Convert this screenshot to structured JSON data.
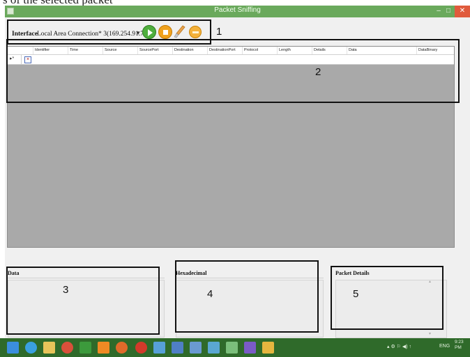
{
  "caption_fragment": "s of the selected packet",
  "window": {
    "title": "Packet Sniffing",
    "minimize_glyph": "–",
    "maximize_glyph": "□",
    "close_glyph": "✕"
  },
  "toolbar": {
    "interface_label": "Interface",
    "interface_value": "Local Area Connection* 3(169.254.91.73)",
    "dropdown_glyph": "▾",
    "icons": [
      "start-capture-icon",
      "stop-capture-icon",
      "clear-icon",
      "save-icon"
    ]
  },
  "grid": {
    "columns": [
      "Identifier",
      "Time",
      "Source",
      "SourcePort",
      "Destination",
      "DestinationPort",
      "Protocol",
      "Length",
      "Details",
      "Data",
      "DataBinary"
    ],
    "row_marker": "▸*",
    "row_cell": "×"
  },
  "panels": {
    "data": {
      "title": "Data"
    },
    "hex": {
      "title": "Hexadecimal"
    },
    "details": {
      "title": "Packet Details"
    },
    "scroll_up": "▴",
    "scroll_down": "▾"
  },
  "annotations": [
    "1",
    "2",
    "3",
    "4",
    "5"
  ],
  "taskbar": {
    "icons": [
      "start-icon",
      "ie-icon",
      "explorer-icon",
      "chrome-icon",
      "store-icon",
      "vlc-icon",
      "firefox-icon",
      "opera-icon",
      "network-icon",
      "word-icon",
      "settings-icon",
      "paint-icon",
      "tool-icon",
      "visual-studio-icon",
      "app-icon"
    ],
    "tray": "▴ ⚙ ⚐ ◀) ↑",
    "lang": "ENG",
    "time": "9:23 PM"
  },
  "colors": {
    "titlebar": "#6aa95c",
    "close": "#e05a3c",
    "grid_bg": "#a9a9a9",
    "taskbar": "#2f6a2a"
  }
}
